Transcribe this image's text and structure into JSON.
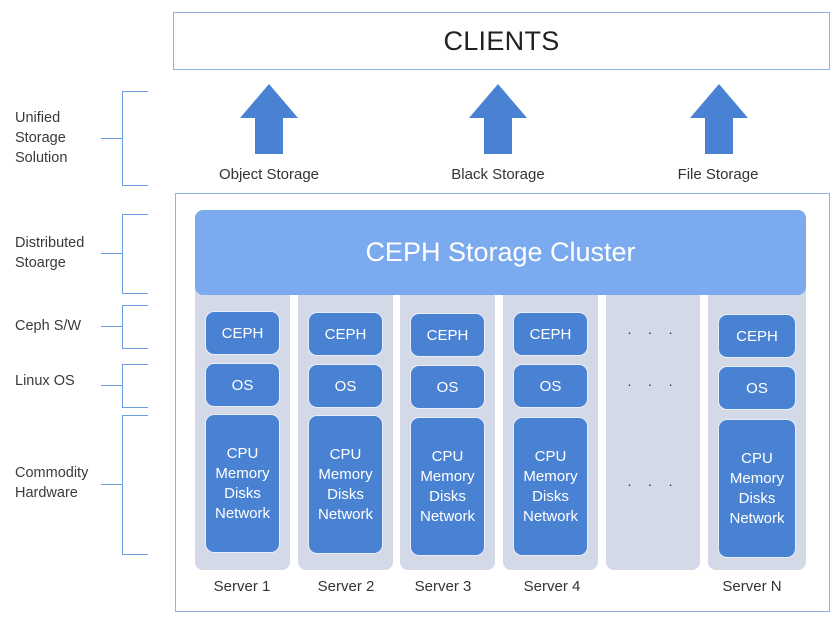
{
  "layers": [
    {
      "label_lines": [
        "Unified",
        "Storage",
        "Solution"
      ]
    },
    {
      "label_lines": [
        "Distributed",
        "Stoarge"
      ]
    },
    {
      "label_lines": [
        "Ceph S/W"
      ]
    },
    {
      "label_lines": [
        "Linux OS"
      ]
    },
    {
      "label_lines": [
        "Commodity",
        "Hardware"
      ]
    }
  ],
  "clients": {
    "label": "CLIENTS"
  },
  "interfaces": [
    {
      "label": "Object Storage",
      "icon": "arrow-up-icon"
    },
    {
      "label": "Black Storage",
      "icon": "arrow-up-icon"
    },
    {
      "label": "File Storage",
      "icon": "arrow-up-icon"
    }
  ],
  "cluster": {
    "title": "CEPH Storage Cluster"
  },
  "servers": [
    {
      "name": "Server 1",
      "software": "CEPH",
      "os": "OS",
      "hardware": [
        "CPU",
        "Memory",
        "Disks",
        "Network"
      ]
    },
    {
      "name": "Server 2",
      "software": "CEPH",
      "os": "OS",
      "hardware": [
        "CPU",
        "Memory",
        "Disks",
        "Network"
      ]
    },
    {
      "name": "Server 3",
      "software": "CEPH",
      "os": "OS",
      "hardware": [
        "CPU",
        "Memory",
        "Disks",
        "Network"
      ]
    },
    {
      "name": "Server 4",
      "software": "CEPH",
      "os": "OS",
      "hardware": [
        "CPU",
        "Memory",
        "Disks",
        "Network"
      ]
    },
    {
      "name": "Server N",
      "software": "CEPH",
      "os": "OS",
      "hardware": [
        "CPU",
        "Memory",
        "Disks",
        "Network"
      ]
    }
  ],
  "ellipsis": "· · ·",
  "colors": {
    "accent": "#4a82d3",
    "cluster": "#7baaee",
    "column": "#d3d9e6",
    "border": "#8eb3e8"
  }
}
